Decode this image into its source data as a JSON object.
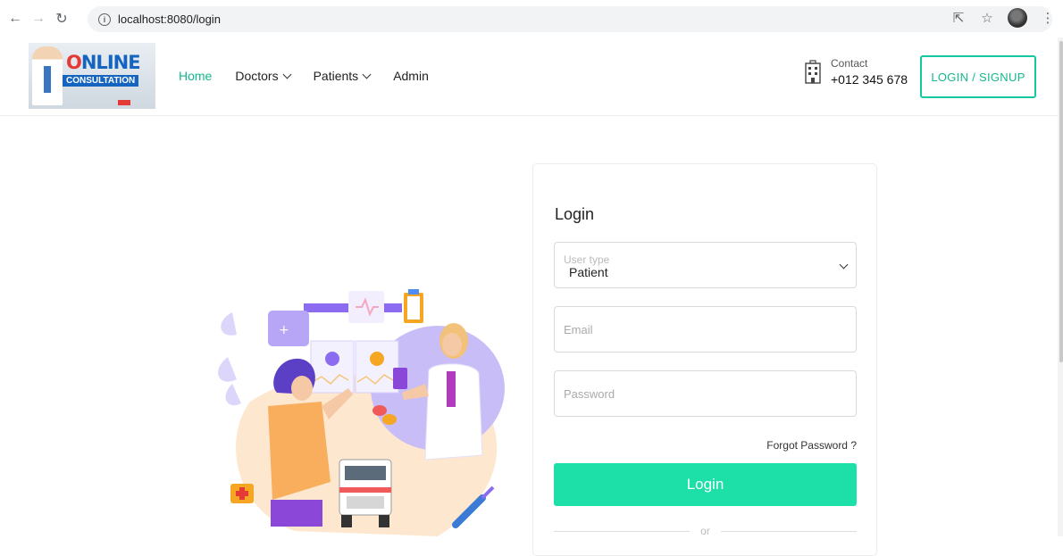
{
  "browser": {
    "url": "localhost:8080/login",
    "icons": [
      "back-arrow-icon",
      "forward-arrow-icon",
      "reload-icon",
      "info-icon",
      "share-icon",
      "star-icon",
      "profile-avatar",
      "menu-dots-icon"
    ]
  },
  "header": {
    "logo": {
      "line1_prefix": "O",
      "line1_rest": "NLINE",
      "line2": "CONSULTATION"
    },
    "nav": [
      {
        "label": "Home",
        "active": true,
        "dropdown": false
      },
      {
        "label": "Doctors",
        "active": false,
        "dropdown": true
      },
      {
        "label": "Patients",
        "active": false,
        "dropdown": true
      },
      {
        "label": "Admin",
        "active": false,
        "dropdown": false
      }
    ],
    "contact": {
      "label": "Contact",
      "phone": "+012 345 678",
      "icon": "building-icon"
    },
    "login_signup_label": "LOGIN / SIGNUP"
  },
  "login_card": {
    "title": "Login",
    "user_type": {
      "label": "User type",
      "value": "Patient"
    },
    "email": {
      "placeholder": "Email",
      "value": ""
    },
    "password": {
      "placeholder": "Password",
      "value": ""
    },
    "forgot_label": "Forgot Password ?",
    "submit_label": "Login",
    "divider_label": "or"
  },
  "colors": {
    "accent": "#14b88c",
    "button": "#1de0a8",
    "outline": "#14c9a0",
    "illustration_purple": "#8b6cf0",
    "illustration_orange": "#f5a623"
  }
}
